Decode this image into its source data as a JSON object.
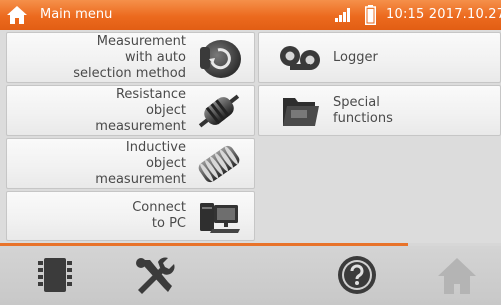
{
  "titlebar": {
    "title": "Main menu",
    "clock": "10:15 2017.10.27",
    "icons": [
      "home-icon",
      "signal-icon",
      "battery-icon"
    ]
  },
  "menu": {
    "left": [
      {
        "label": "Measurement\nwith auto\nselection method",
        "icon": "auto-measurement-icon"
      },
      {
        "label": "Resistance\nobject\nmeasurement",
        "icon": "resistor-icon"
      },
      {
        "label": "Inductive\nobject\nmeasurement",
        "icon": "coil-icon"
      },
      {
        "label": "Connect\nto PC",
        "icon": "computer-icon"
      }
    ],
    "right": [
      {
        "label": "Logger",
        "icon": "logger-icon"
      },
      {
        "label": "Special\nfunctions",
        "icon": "folder-icon"
      }
    ]
  },
  "bottombar": {
    "buttons": [
      "memory-icon",
      "settings-icon",
      "help-icon",
      "home-disabled-icon"
    ]
  },
  "colors": {
    "accent": "#ec6a1e",
    "tile": "#f3f3f3",
    "background": "#dcdcdc"
  }
}
